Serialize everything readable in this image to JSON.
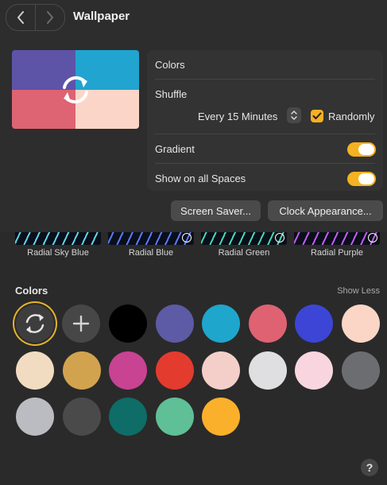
{
  "window": {
    "title": "Wallpaper"
  },
  "icons": {
    "back": "chevron-left-icon",
    "forward": "chevron-right-icon"
  },
  "preview": {
    "colors": [
      "#5d54a8",
      "#21a4cf",
      "#de6373",
      "#fbd6c8"
    ]
  },
  "panel": {
    "colors_label": "Colors",
    "shuffle_label": "Shuffle",
    "interval_value": "Every 15 Minutes",
    "randomly_label": "Randomly",
    "randomly_checked": true,
    "gradient_label": "Gradient",
    "gradient_on": true,
    "spaces_label": "Show on all Spaces",
    "spaces_on": true
  },
  "buttons": {
    "screen_saver": "Screen Saver...",
    "clock": "Clock Appearance..."
  },
  "thumbnails": [
    {
      "label": "Radial Sky Blue",
      "accent": "#5fd4ea"
    },
    {
      "label": "Radial Blue",
      "accent": "#5a7bff"
    },
    {
      "label": "Radial Green",
      "accent": "#47d9b0"
    },
    {
      "label": "Radial Purple",
      "accent": "#c45cf0"
    }
  ],
  "colors_section": {
    "title": "Colors",
    "show_less": "Show Less",
    "swatches": [
      "#000000",
      "#5d5aa6",
      "#1fa6cd",
      "#df6272",
      "#3c45d6",
      "#fbd6c6",
      "#f1dcc1",
      "#d2a34e",
      "#c84392",
      "#e43b2f",
      "#f4cfca",
      "#dfdfe1",
      "#f9d6df",
      "#6c6d71",
      "#bbbcc1",
      "#4a4a4a",
      "#0e6d67",
      "#5fbf97",
      "#fbb02b"
    ]
  },
  "help": {
    "label": "?"
  }
}
